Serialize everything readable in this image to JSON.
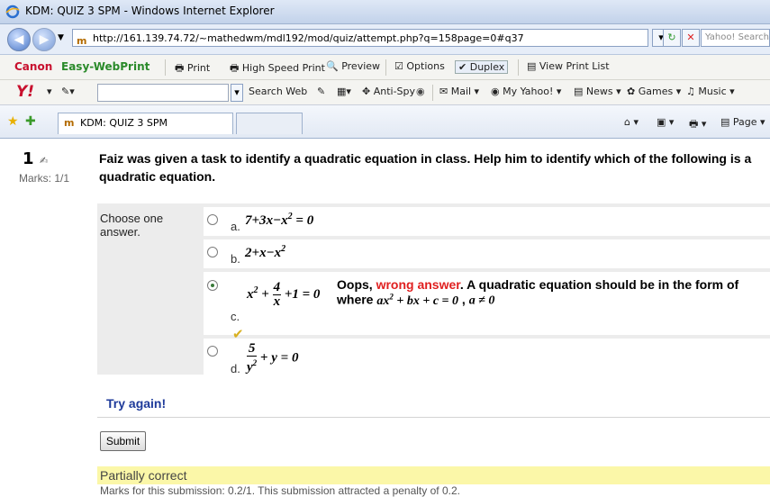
{
  "window": {
    "title": "KDM: QUIZ 3 SPM - Windows Internet Explorer"
  },
  "navbar": {
    "url": "http://161.139.74.72/~mathedwm/mdl192/mod/quiz/attempt.php?q=158page=0#q37",
    "search_placeholder": "Yahoo! Search"
  },
  "canon_toolbar": {
    "brand": "Canon",
    "product": "Easy-WebPrint",
    "items": [
      "Print",
      "High Speed Print",
      "Preview",
      "Options",
      "Duplex",
      "View Print List"
    ]
  },
  "yahoo_toolbar": {
    "search_web": "Search Web",
    "items": [
      "Anti-Spy",
      "Mail",
      "My Yahoo!",
      "News",
      "Games",
      "Music"
    ]
  },
  "tabs": {
    "active_tab": "KDM: QUIZ 3 SPM",
    "tools": [
      "Page"
    ]
  },
  "question": {
    "number": "1",
    "marks": "Marks: 1/1",
    "text": "Faiz was given a task to identify a quadratic equation in class. Help him to identify which of the following is a quadratic equation.",
    "choose_label": "Choose one answer.",
    "options": [
      {
        "letter": "a.",
        "expr": "7+3x−x² = 0",
        "selected": false
      },
      {
        "letter": "b.",
        "expr": "2+x−x²",
        "selected": false
      },
      {
        "letter": "c.",
        "expr": "x² + 4/x + 1 = 0",
        "selected": true
      },
      {
        "letter": "d.",
        "expr": "5/y² + y = 0",
        "selected": false
      }
    ],
    "feedback_prefix": "Oops, ",
    "feedback_wrong": "wrong answer",
    "feedback_rest": ". A quadratic equation should be in the form of",
    "feedback_where": "where",
    "feedback_formula": "ax² + bx + c = 0",
    "feedback_cond": "a ≠ 0"
  },
  "actions": {
    "try_again": "Try again!",
    "submit": "Submit"
  },
  "result": {
    "status": "Partially correct",
    "marks_text": "Marks for this submission: 0.2/1. This submission attracted a penalty of 0.2."
  },
  "colors": {
    "wrong": "#e02020",
    "try_again": "#1e3a9a",
    "partial_bg": "#fbf7a8"
  }
}
